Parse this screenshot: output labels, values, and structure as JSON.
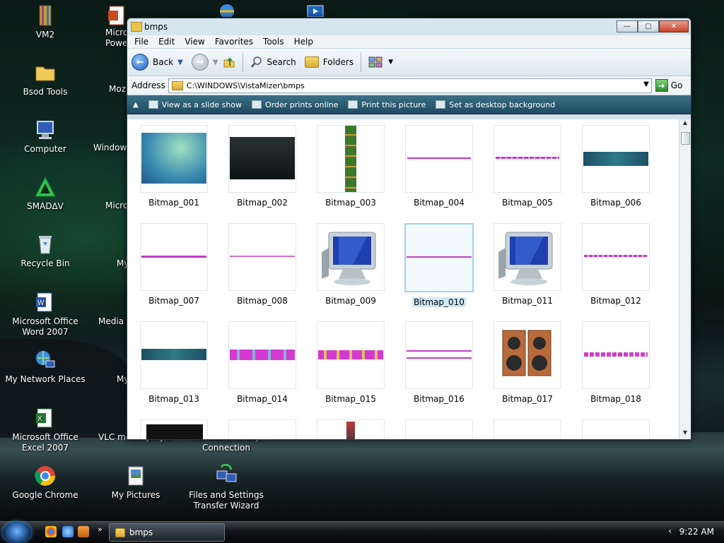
{
  "desktop": {
    "icons": [
      {
        "label": "VM2",
        "icon": "winrar-archive-icon"
      },
      {
        "label": "Bsod Tools",
        "icon": "folder-icon"
      },
      {
        "label": "Computer",
        "icon": "computer-icon"
      },
      {
        "label": "SMAD∆V",
        "icon": "smadav-icon"
      },
      {
        "label": "Recycle Bin",
        "icon": "recycle-bin-icon"
      },
      {
        "label": "Microsoft Office Word 2007",
        "icon": "word-icon"
      },
      {
        "label": "My Network Places",
        "icon": "network-places-icon"
      },
      {
        "label": "Microsoft Office Excel 2007",
        "icon": "excel-icon"
      },
      {
        "label": "Google Chrome",
        "icon": "chrome-icon"
      },
      {
        "label": "Micro Powe",
        "icon": "powerpoint-icon"
      },
      {
        "label": "Moz",
        "icon": "firefox-icon"
      },
      {
        "label": "Windows",
        "icon": "windows-icon"
      },
      {
        "label": "Micro",
        "icon": "app-icon"
      },
      {
        "label": "My",
        "icon": "app-icon"
      },
      {
        "label": "Media I",
        "icon": "media-icon"
      },
      {
        "label": "My",
        "icon": "app-icon"
      },
      {
        "label": "VLC media player",
        "icon": "vlc-icon"
      },
      {
        "label": "My Pictures",
        "icon": "pictures-icon"
      },
      {
        "label": "Remote Desktop Connection",
        "icon": "remote-desktop-icon"
      },
      {
        "label": "Files and Settings Transfer Wizard",
        "icon": "transfer-wizard-icon"
      }
    ]
  },
  "window": {
    "title": "bmps",
    "menu": [
      "File",
      "Edit",
      "View",
      "Favorites",
      "Tools",
      "Help"
    ],
    "toolbar": {
      "back": "Back",
      "search": "Search",
      "folders": "Folders"
    },
    "address": {
      "label": "Address",
      "path": "C:\\WINDOWS\\VistaMizer\\bmps",
      "go": "Go"
    },
    "tasks": [
      "View as a slide show",
      "Order prints online",
      "Print this picture",
      "Set as desktop background"
    ],
    "thumbnails": [
      "Bitmap_001",
      "Bitmap_002",
      "Bitmap_003",
      "Bitmap_004",
      "Bitmap_005",
      "Bitmap_006",
      "Bitmap_007",
      "Bitmap_008",
      "Bitmap_009",
      "Bitmap_010",
      "Bitmap_011",
      "Bitmap_012",
      "Bitmap_013",
      "Bitmap_014",
      "Bitmap_015",
      "Bitmap_016",
      "Bitmap_017",
      "Bitmap_018"
    ],
    "selected": "Bitmap_010"
  },
  "taskbar": {
    "task": "bmps",
    "time": "9:22 AM"
  },
  "colors": {
    "accent": "#1f5fb8",
    "selection": "#cde8f7",
    "taskpane": "#2a5a70"
  }
}
